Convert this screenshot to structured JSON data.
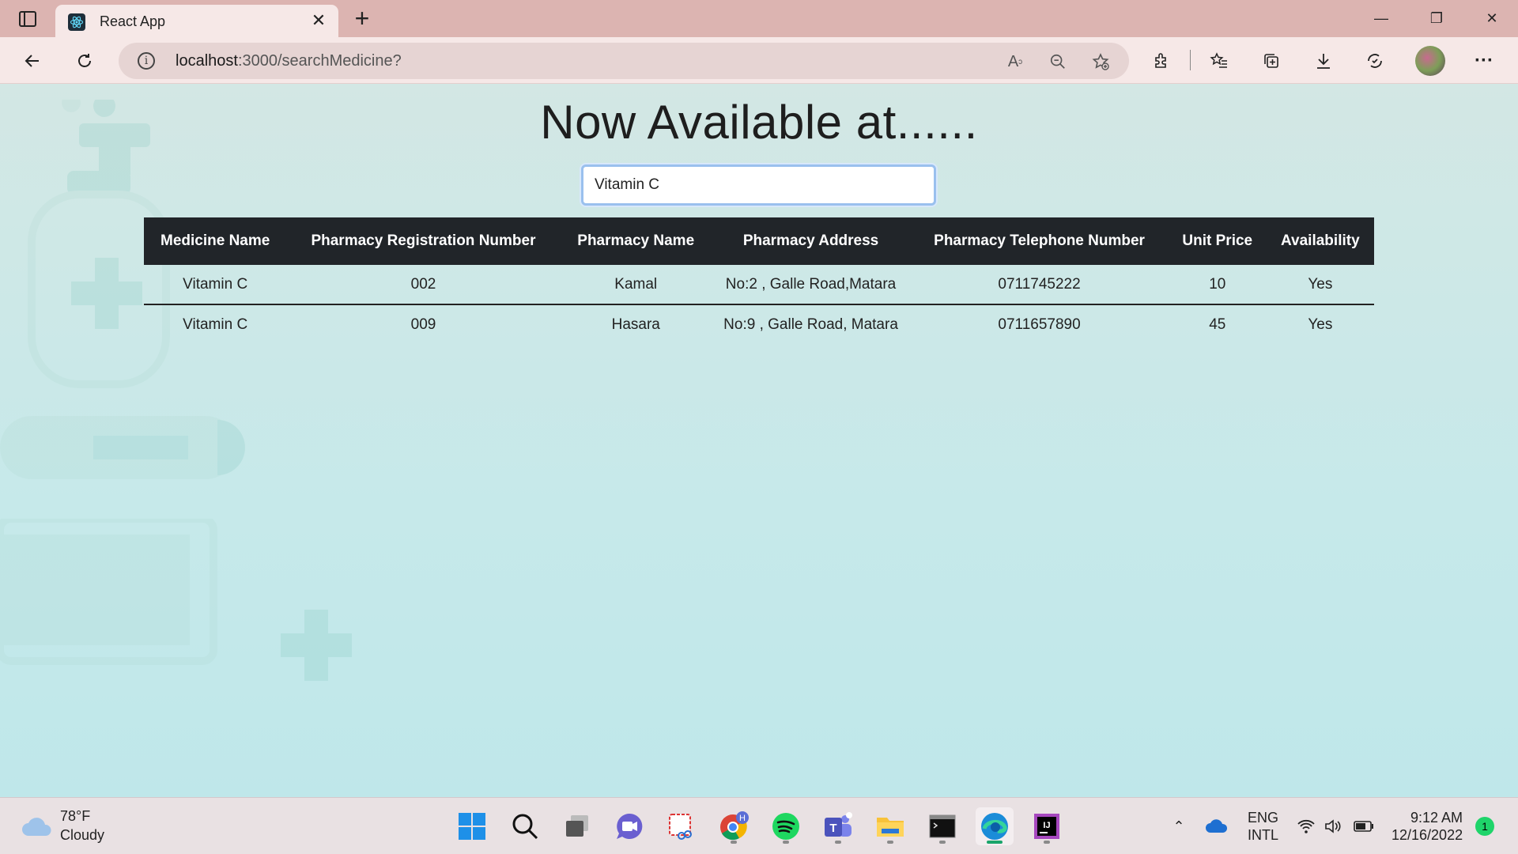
{
  "browser": {
    "tab_title": "React App",
    "url_host": "localhost",
    "url_path": ":3000/searchMedicine?"
  },
  "page": {
    "title": "Now Available at......",
    "search": {
      "value": "Vitamin C"
    }
  },
  "table": {
    "headers": [
      "Medicine Name",
      "Pharmacy Registration Number",
      "Pharmacy Name",
      "Pharmacy Address",
      "Pharmacy Telephone Number",
      "Unit Price",
      "Availability"
    ],
    "rows": [
      [
        "Vitamin C",
        "002",
        "Kamal",
        "No:2 , Galle Road,Matara",
        "0711745222",
        "10",
        "Yes"
      ],
      [
        "Vitamin C",
        "009",
        "Hasara",
        "No:9 , Galle Road, Matara",
        "0711657890",
        "45",
        "Yes"
      ]
    ]
  },
  "taskbar": {
    "weather_temp": "78°F",
    "weather_desc": "Cloudy",
    "lang_1": "ENG",
    "lang_2": "INTL",
    "time": "9:12 AM",
    "date": "12/16/2022",
    "notification_count": "1",
    "chrome_badge": "H"
  },
  "icons": {
    "tab_actions": "tab-actions-icon",
    "favicon": "react-icon",
    "back": "back-arrow-icon",
    "reload": "reload-icon",
    "info": "info-icon",
    "read_aloud": "read-aloud-icon",
    "zoom": "zoom-out-icon",
    "favorite_add": "add-favorite-icon",
    "extensions": "puzzle-icon",
    "favorites": "favorites-icon",
    "collections": "collections-icon",
    "downloads": "download-icon",
    "feedback": "browser-essentials-icon",
    "more": "more-icon"
  },
  "colors": {
    "header_bg": "#212529",
    "tabbar_bg": "#dcb4b1",
    "input_focus": "#9ac0ee"
  }
}
